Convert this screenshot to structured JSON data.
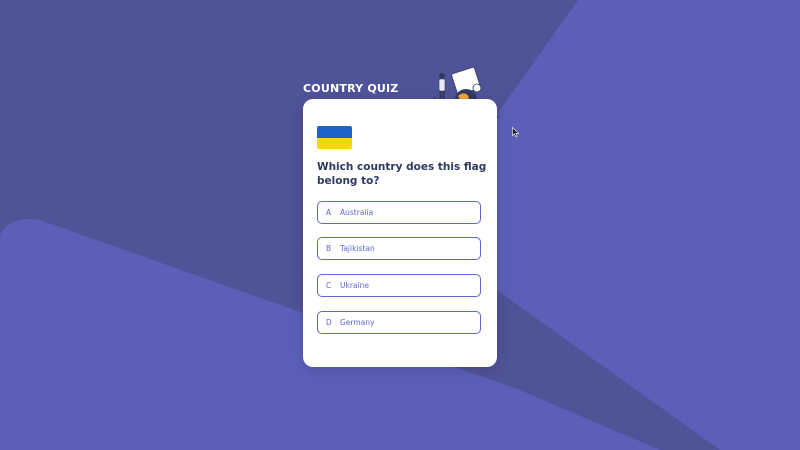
{
  "colors": {
    "background_dark": "#4f5397",
    "background_light": "#5b5fb8",
    "card": "#ffffff",
    "accent": "#6066d0",
    "question_text": "#2f3a5f",
    "flag_blue": "#1f63c6",
    "flag_yellow": "#f9d616"
  },
  "quiz": {
    "title": "COUNTRY QUIZ",
    "flag_icon": "flag-ukraine",
    "question": "Which country does this flag belong to?",
    "options": [
      {
        "letter": "A",
        "text": "Australia"
      },
      {
        "letter": "B",
        "text": "Tajikistan"
      },
      {
        "letter": "C",
        "text": "Ukraine"
      },
      {
        "letter": "D",
        "text": "Germany"
      }
    ]
  },
  "icons": {
    "illustration": "traveler-with-globe-illustration",
    "cursor": "mouse-pointer-icon"
  }
}
